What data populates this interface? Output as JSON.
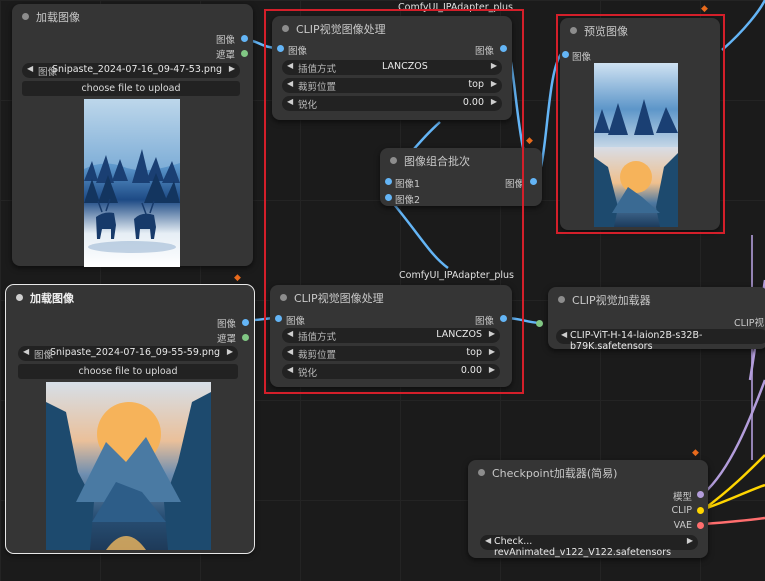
{
  "colors": {
    "accent_red": "#d41f2a",
    "image_port": "#64b5f6",
    "mask_port": "#81c784",
    "model_port": "#b39ddb",
    "clip_port": "#ffd500",
    "vae_port": "#ff6e6e",
    "fox": "#e86a1c"
  },
  "canvas_labels": {
    "top_node_title": "ComfyUI_IPAdapter_plus",
    "mid_node_title": "ComfyUI_IPAdapter_plus"
  },
  "load_image_1": {
    "title": "加载图像",
    "out_image": "图像",
    "out_mask": "遮罩",
    "image_label": "图像",
    "image_value": "Snipaste_2024-07-16_09-47-53.png",
    "upload_label": "choose file to upload"
  },
  "load_image_2": {
    "title": "加载图像",
    "out_image": "图像",
    "out_mask": "遮罩",
    "image_label": "图像",
    "image_value": "Snipaste_2024-07-16_09-55-59.png",
    "upload_label": "choose file to upload"
  },
  "clip_prep_1": {
    "title": "CLIP视觉图像处理",
    "in_image": "图像",
    "out_image": "图像",
    "interp_label": "插值方式",
    "interp_value": "LANCZOS",
    "crop_label": "裁剪位置",
    "crop_value": "top",
    "sharp_label": "锐化",
    "sharp_value": "0.00"
  },
  "clip_prep_2": {
    "title": "CLIP视觉图像处理",
    "in_image": "图像",
    "out_image": "图像",
    "interp_label": "插值方式",
    "interp_value": "LANCZOS",
    "crop_label": "裁剪位置",
    "crop_value": "top",
    "sharp_label": "锐化",
    "sharp_value": "0.00"
  },
  "batch": {
    "title": "图像组合批次",
    "in_image1": "图像1",
    "in_image2": "图像2",
    "out_image": "图像"
  },
  "preview": {
    "title": "预览图像",
    "in_image": "图像"
  },
  "clip_loader": {
    "title": "CLIP视觉加载器",
    "out_clip": "CLIP视",
    "model_value": "CLIP-ViT-H-14-laion2B-s32B-b79K.safetensors"
  },
  "checkpoint": {
    "title": "Checkpoint加载器(简易)",
    "out_model": "模型",
    "out_clip": "CLIP",
    "out_vae": "VAE",
    "ckpt_value": "Check... revAnimated_v122_V122.safetensors"
  }
}
